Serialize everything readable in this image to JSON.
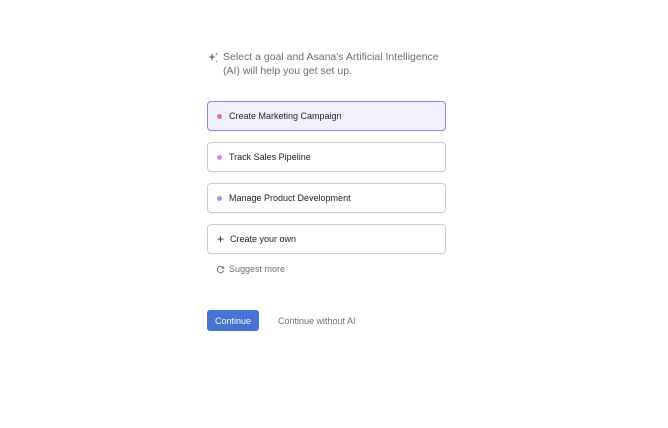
{
  "intro": {
    "text": "Select a goal and Asana's Artificial Intelligence (AI) will help you get set up."
  },
  "goals": [
    {
      "label": "Create Marketing Campaign",
      "dot_color": "#f06a99",
      "selected": true
    },
    {
      "label": "Track Sales Pipeline",
      "dot_color": "#d68ae6",
      "selected": false
    },
    {
      "label": "Manage Product Development",
      "dot_color": "#a895f0",
      "selected": false
    },
    {
      "label": "Create your own",
      "icon": "plus-icon",
      "selected": false
    }
  ],
  "suggest": {
    "label": "Suggest more",
    "icon": "refresh-icon"
  },
  "actions": {
    "continue_label": "Continue",
    "without_ai_label": "Continue without AI"
  },
  "colors": {
    "primary": "#4573d2",
    "selected_border": "#8d84e8",
    "selected_bg": "#f1f1fd"
  }
}
